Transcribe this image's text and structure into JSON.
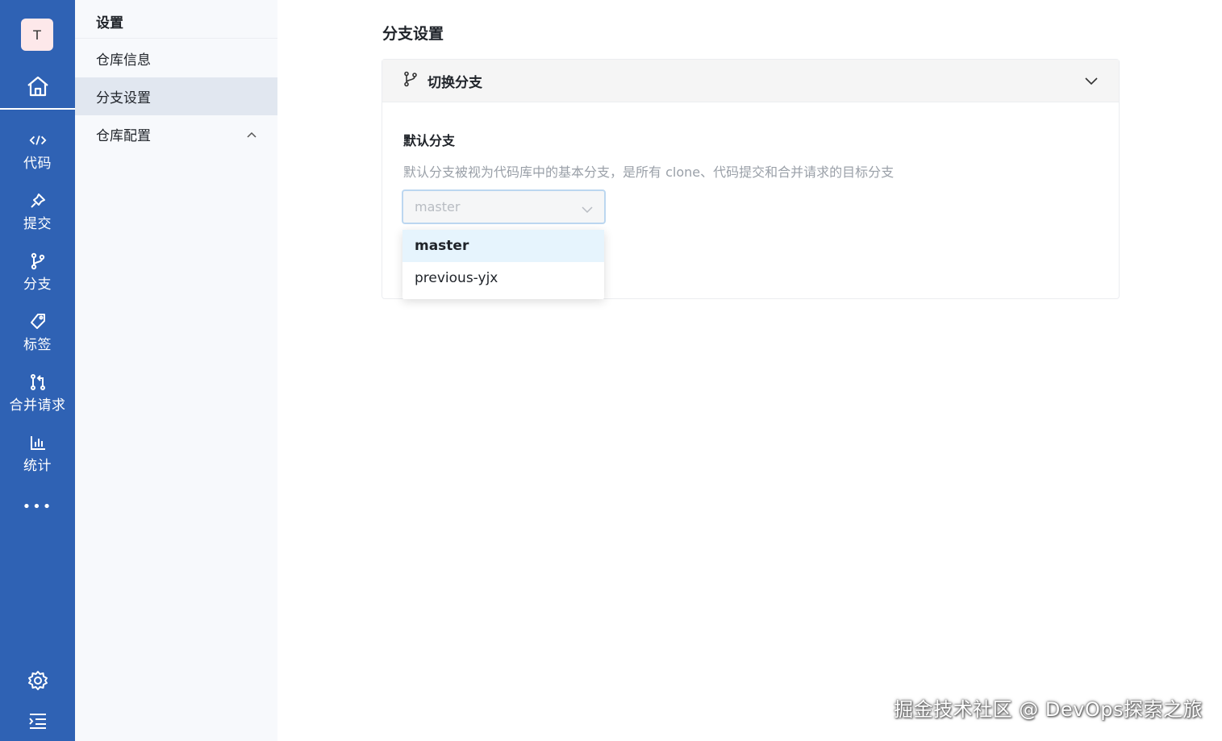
{
  "rail": {
    "avatar_letter": "T",
    "items": [
      {
        "label": "代码",
        "icon": "code-icon"
      },
      {
        "label": "提交",
        "icon": "pin-icon"
      },
      {
        "label": "分支",
        "icon": "branch-icon"
      },
      {
        "label": "标签",
        "icon": "tag-icon"
      },
      {
        "label": "合并请求",
        "icon": "merge-request-icon"
      },
      {
        "label": "统计",
        "icon": "chart-icon"
      }
    ],
    "more": "•••"
  },
  "sidebar": {
    "title": "设置",
    "items": [
      {
        "label": "仓库信息"
      },
      {
        "label": "分支设置",
        "active": true
      },
      {
        "label": "仓库配置",
        "caret": "^"
      }
    ]
  },
  "main": {
    "title": "分支设置",
    "card": {
      "header": "切换分支",
      "field_label": "默认分支",
      "field_desc": "默认分支被视为代码库中的基本分支，是所有 clone、代码提交和合并请求的目标分支",
      "select_value": "master"
    },
    "dropdown": {
      "options": [
        "master",
        "previous-yjx"
      ],
      "selected": "master"
    }
  },
  "watermark": "掘金技术社区 @ DevOps探索之旅",
  "colors": {
    "rail": "#2f62b4",
    "sidebar_active": "#e1e7f0",
    "option_selected": "#e6f4fd"
  }
}
